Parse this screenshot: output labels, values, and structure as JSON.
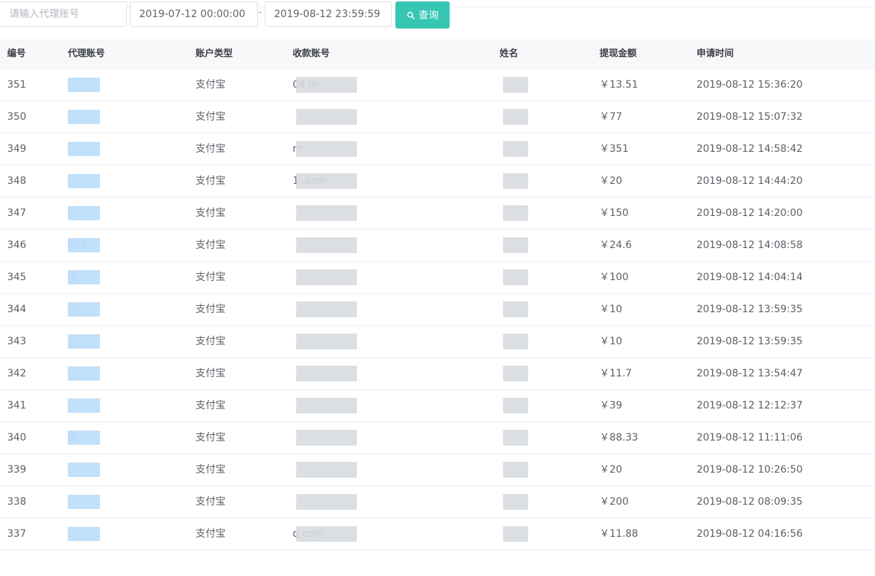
{
  "filters": {
    "agent_placeholder": "请输入代理账号",
    "date_start": "2019-07-12 00:00:00",
    "date_sep": "-",
    "date_end": "2019-08-12 23:59:59",
    "search_label": "查询",
    "search_icon": "search-icon"
  },
  "table": {
    "headers": {
      "id": "编号",
      "agent": "代理账号",
      "type": "账户类型",
      "account": "收款账号",
      "name": "姓名",
      "amount": "提现金额",
      "time": "申请时间"
    },
    "rows": [
      {
        "id": "351",
        "agent": "",
        "type": "支付宝",
        "account": "04 m",
        "name": "",
        "amount": "￥13.51",
        "time": "2019-08-12 15:36:20"
      },
      {
        "id": "350",
        "agent": "",
        "type": "支付宝",
        "account": "",
        "name": "",
        "amount": "￥77",
        "time": "2019-08-12 15:07:32"
      },
      {
        "id": "349",
        "agent": "",
        "type": "支付宝",
        "account": "m",
        "name": "",
        "amount": "￥351",
        "time": "2019-08-12 14:58:42"
      },
      {
        "id": "348",
        "agent": "",
        "type": "支付宝",
        "account": "1 .com",
        "name": "",
        "amount": "￥20",
        "time": "2019-08-12 14:44:20"
      },
      {
        "id": "347",
        "agent": "叶",
        "type": "支付宝",
        "account": "",
        "name": "",
        "amount": "￥150",
        "time": "2019-08-12 14:20:00"
      },
      {
        "id": "346",
        "agent": "柳虎",
        "type": "支付宝",
        "account": "",
        "name": "",
        "amount": "￥24.6",
        "time": "2019-08-12 14:08:58"
      },
      {
        "id": "345",
        "agent": "情",
        "type": "支付宝",
        "account": "",
        "name": "",
        "amount": "￥100",
        "time": "2019-08-12 14:04:14"
      },
      {
        "id": "344",
        "agent": "37",
        "type": "支付宝",
        "account": "",
        "name": "",
        "amount": "￥10",
        "time": "2019-08-12 13:59:35"
      },
      {
        "id": "343",
        "agent": "7",
        "type": "支付宝",
        "account": "",
        "name": "",
        "amount": "￥10",
        "time": "2019-08-12 13:59:35"
      },
      {
        "id": "342",
        "agent": "",
        "type": "支付宝",
        "account": "",
        "name": "",
        "amount": "￥11.7",
        "time": "2019-08-12 13:54:47"
      },
      {
        "id": "341",
        "agent": "",
        "type": "支付宝",
        "account": "",
        "name": "",
        "amount": "￥39",
        "time": "2019-08-12 12:12:37"
      },
      {
        "id": "340",
        "agent": "雁",
        "type": "支付宝",
        "account": "",
        "name": "",
        "amount": "￥88.33",
        "time": "2019-08-12 11:11:06"
      },
      {
        "id": "339",
        "agent": "",
        "type": "支付宝",
        "account": "",
        "name": "",
        "amount": "￥20",
        "time": "2019-08-12 10:26:50"
      },
      {
        "id": "338",
        "agent": "",
        "type": "支付宝",
        "account": "",
        "name": "",
        "amount": "￥200",
        "time": "2019-08-12 08:09:35"
      },
      {
        "id": "337",
        "agent": "",
        "type": "支付宝",
        "account": "q.com",
        "name": "",
        "amount": "￥11.88",
        "time": "2019-08-12 04:16:56"
      }
    ]
  }
}
